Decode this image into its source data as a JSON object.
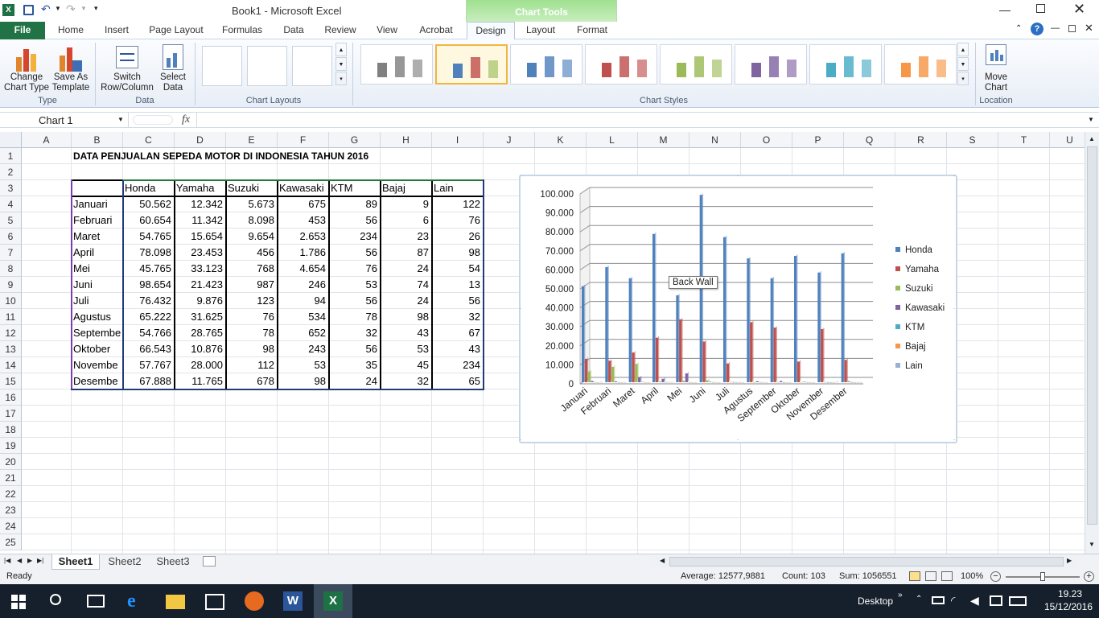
{
  "window": {
    "title": "Book1  -  Microsoft Excel",
    "context_tab_group": "Chart Tools"
  },
  "tabs": [
    "File",
    "Home",
    "Insert",
    "Page Layout",
    "Formulas",
    "Data",
    "Review",
    "View",
    "Acrobat",
    "Design",
    "Layout",
    "Format"
  ],
  "active_tab": "Design",
  "ribbon": {
    "change_chart_type": "Change Chart Type",
    "save_as_template": "Save As Template",
    "switch_row_column": "Switch Row/Column",
    "select_data": "Select Data",
    "move_chart": "Move Chart",
    "groups": {
      "type": "Type",
      "data": "Data",
      "chart_layouts": "Chart Layouts",
      "chart_styles": "Chart Styles",
      "location": "Location"
    },
    "style_colors": [
      "#808080",
      "#4f81bd",
      "#4f81bd",
      "#c0504d",
      "#9bbb59",
      "#8064a2",
      "#4bacc6",
      "#f79646"
    ]
  },
  "formula_bar": {
    "name_box": "Chart 1",
    "fx": "fx",
    "value": ""
  },
  "columns": [
    "A",
    "B",
    "C",
    "D",
    "E",
    "F",
    "G",
    "H",
    "I",
    "J",
    "K",
    "L",
    "M",
    "N",
    "O",
    "P",
    "Q",
    "R",
    "S",
    "T",
    "U"
  ],
  "rows": [
    "1",
    "2",
    "3",
    "4",
    "5",
    "6",
    "7",
    "8",
    "9",
    "10",
    "11",
    "12",
    "13",
    "14",
    "15",
    "16",
    "17",
    "18",
    "19",
    "20",
    "21",
    "22",
    "23",
    "24",
    "25"
  ],
  "sheet": {
    "title": "DATA PENJUALAN SEPEDA MOTOR DI INDONESIA TAHUN 2016",
    "headers": [
      "Honda",
      "Yamaha",
      "Suzuki",
      "Kawasaki",
      "KTM",
      "Bajaj",
      "Lain"
    ],
    "table": [
      [
        "Januari",
        "50.562",
        "12.342",
        "5.673",
        "675",
        "89",
        "9",
        "122"
      ],
      [
        "Februari",
        "60.654",
        "11.342",
        "8.098",
        "453",
        "56",
        "6",
        "76"
      ],
      [
        "Maret",
        "54.765",
        "15.654",
        "9.654",
        "2.653",
        "234",
        "23",
        "26"
      ],
      [
        "April",
        "78.098",
        "23.453",
        "456",
        "1.786",
        "56",
        "87",
        "98"
      ],
      [
        "Mei",
        "45.765",
        "33.123",
        "768",
        "4.654",
        "76",
        "24",
        "54"
      ],
      [
        "Juni",
        "98.654",
        "21.423",
        "987",
        "246",
        "53",
        "74",
        "13"
      ],
      [
        "Juli",
        "76.432",
        "9.876",
        "123",
        "94",
        "56",
        "24",
        "56"
      ],
      [
        "Agustus",
        "65.222",
        "31.625",
        "76",
        "534",
        "78",
        "98",
        "32"
      ],
      [
        "Septembe",
        "54.766",
        "28.765",
        "78",
        "652",
        "32",
        "43",
        "67"
      ],
      [
        "Oktober",
        "66.543",
        "10.876",
        "98",
        "243",
        "56",
        "53",
        "43"
      ],
      [
        "Novembe",
        "57.767",
        "28.000",
        "112",
        "53",
        "35",
        "45",
        "234"
      ],
      [
        "Desembe",
        "67.888",
        "11.765",
        "678",
        "98",
        "24",
        "32",
        "65"
      ]
    ]
  },
  "chart_data": {
    "type": "bar",
    "categories": [
      "Januari",
      "Februari",
      "Maret",
      "April",
      "Mei",
      "Juni",
      "Juli",
      "Agustus",
      "September",
      "Oktober",
      "November",
      "Desember"
    ],
    "series": [
      {
        "name": "Honda",
        "color": "#4f81bd",
        "values": [
          50562,
          60654,
          54765,
          78098,
          45765,
          98654,
          76432,
          65222,
          54766,
          66543,
          57767,
          67888
        ]
      },
      {
        "name": "Yamaha",
        "color": "#c0504d",
        "values": [
          12342,
          11342,
          15654,
          23453,
          33123,
          21423,
          9876,
          31625,
          28765,
          10876,
          28000,
          11765
        ]
      },
      {
        "name": "Suzuki",
        "color": "#9bbb59",
        "values": [
          5673,
          8098,
          9654,
          456,
          768,
          987,
          123,
          76,
          78,
          98,
          112,
          678
        ]
      },
      {
        "name": "Kawasaki",
        "color": "#8064a2",
        "values": [
          675,
          453,
          2653,
          1786,
          4654,
          246,
          94,
          534,
          652,
          243,
          53,
          98
        ]
      },
      {
        "name": "KTM",
        "color": "#4bacc6",
        "values": [
          89,
          56,
          234,
          56,
          76,
          53,
          56,
          78,
          32,
          56,
          35,
          24
        ]
      },
      {
        "name": "Bajaj",
        "color": "#f79646",
        "values": [
          9,
          6,
          23,
          87,
          24,
          74,
          24,
          98,
          43,
          53,
          45,
          32
        ]
      },
      {
        "name": "Lain",
        "color": "#95b3d7",
        "values": [
          122,
          76,
          26,
          98,
          54,
          13,
          56,
          32,
          67,
          43,
          234,
          65
        ]
      }
    ],
    "yticks": [
      "100.000",
      "90.000",
      "80.000",
      "70.000",
      "60.000",
      "50.000",
      "40.000",
      "30.000",
      "20.000",
      "10.000",
      "0"
    ],
    "ylim": [
      0,
      100000
    ],
    "legend_position": "right",
    "tooltip": "Back Wall"
  },
  "sheets": [
    "Sheet1",
    "Sheet2",
    "Sheet3"
  ],
  "status": {
    "ready": "Ready",
    "average": "Average: 12577,9881",
    "count": "Count: 103",
    "sum": "Sum: 1056551",
    "zoom": "100%"
  },
  "taskbar": {
    "desktop": "Desktop",
    "time": "19.23",
    "date": "15/12/2016"
  }
}
